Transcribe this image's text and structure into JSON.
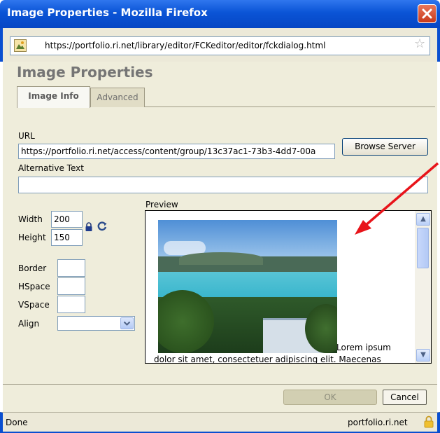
{
  "window": {
    "title": "Image Properties - Mozilla Firefox",
    "url": "https://portfolio.ri.net/library/editor/FCKeditor/editor/fckdialog.html"
  },
  "dialog": {
    "title": "Image Properties",
    "tabs": [
      {
        "label": "Image Info",
        "active": true
      },
      {
        "label": "Advanced",
        "active": false
      }
    ]
  },
  "form": {
    "url_label": "URL",
    "url_value": "https://portfolio.ri.net/access/content/group/13c37ac1-73b3-4dd7-00a",
    "browse_label": "Browse Server",
    "alt_label": "Alternative Text",
    "alt_value": "",
    "width_label": "Width",
    "width_value": "200",
    "height_label": "Height",
    "height_value": "150",
    "border_label": "Border",
    "border_value": "",
    "hspace_label": "HSpace",
    "hspace_value": "",
    "vspace_label": "VSpace",
    "vspace_value": "",
    "align_label": "Align",
    "align_value": "",
    "preview_label": "Preview",
    "preview_text": "Lorem ipsum",
    "preview_text_line2": "dolor sit amet, consectetuer adipiscing elit. Maecenas"
  },
  "buttons": {
    "ok": "OK",
    "cancel": "Cancel"
  },
  "statusbar": {
    "status": "Done",
    "domain": "portfolio.ri.net"
  },
  "icons": {
    "lock": "lock-icon",
    "reset": "reset-size-icon",
    "star": "bookmark-star-icon",
    "site": "site-identity-icon",
    "padlock": "secure-padlock-icon"
  },
  "colors": {
    "titlebar": "#0a54d6",
    "dialog_bg": "#efeddb",
    "annotation_arrow": "#e8141a"
  }
}
